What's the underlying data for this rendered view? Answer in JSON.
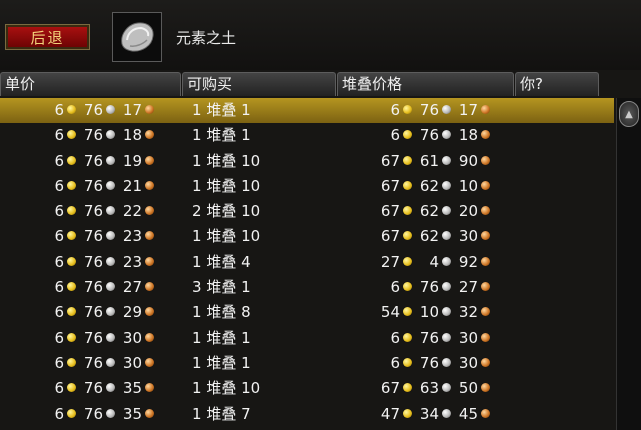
{
  "back_button": "后退",
  "item": {
    "name": "元素之土",
    "icon": "gray-ore-icon"
  },
  "columns": [
    "单价",
    "可购买",
    "堆叠价格",
    "你?"
  ],
  "colors": {
    "selected_row": "#b59520",
    "gold": "#e8c020",
    "silver": "#bcbcbc",
    "copper": "#d07828"
  },
  "rows": [
    {
      "unit": [
        "6",
        "76",
        "17"
      ],
      "qty": "1",
      "stack_word": "堆叠",
      "stack": "1",
      "total": [
        "6",
        "76",
        "17"
      ],
      "selected": true
    },
    {
      "unit": [
        "6",
        "76",
        "18"
      ],
      "qty": "1",
      "stack_word": "堆叠",
      "stack": "1",
      "total": [
        "6",
        "76",
        "18"
      ]
    },
    {
      "unit": [
        "6",
        "76",
        "19"
      ],
      "qty": "1",
      "stack_word": "堆叠",
      "stack": "10",
      "total": [
        "67",
        "61",
        "90"
      ]
    },
    {
      "unit": [
        "6",
        "76",
        "21"
      ],
      "qty": "1",
      "stack_word": "堆叠",
      "stack": "10",
      "total": [
        "67",
        "62",
        "10"
      ]
    },
    {
      "unit": [
        "6",
        "76",
        "22"
      ],
      "qty": "2",
      "stack_word": "堆叠",
      "stack": "10",
      "total": [
        "67",
        "62",
        "20"
      ]
    },
    {
      "unit": [
        "6",
        "76",
        "23"
      ],
      "qty": "1",
      "stack_word": "堆叠",
      "stack": "10",
      "total": [
        "67",
        "62",
        "30"
      ]
    },
    {
      "unit": [
        "6",
        "76",
        "23"
      ],
      "qty": "1",
      "stack_word": "堆叠",
      "stack": "4",
      "total": [
        "27",
        "4",
        "92"
      ]
    },
    {
      "unit": [
        "6",
        "76",
        "27"
      ],
      "qty": "3",
      "stack_word": "堆叠",
      "stack": "1",
      "total": [
        "6",
        "76",
        "27"
      ]
    },
    {
      "unit": [
        "6",
        "76",
        "29"
      ],
      "qty": "1",
      "stack_word": "堆叠",
      "stack": "8",
      "total": [
        "54",
        "10",
        "32"
      ]
    },
    {
      "unit": [
        "6",
        "76",
        "30"
      ],
      "qty": "1",
      "stack_word": "堆叠",
      "stack": "1",
      "total": [
        "6",
        "76",
        "30"
      ]
    },
    {
      "unit": [
        "6",
        "76",
        "30"
      ],
      "qty": "1",
      "stack_word": "堆叠",
      "stack": "1",
      "total": [
        "6",
        "76",
        "30"
      ]
    },
    {
      "unit": [
        "6",
        "76",
        "35"
      ],
      "qty": "1",
      "stack_word": "堆叠",
      "stack": "10",
      "total": [
        "67",
        "63",
        "50"
      ]
    },
    {
      "unit": [
        "6",
        "76",
        "35"
      ],
      "qty": "1",
      "stack_word": "堆叠",
      "stack": "7",
      "total": [
        "47",
        "34",
        "45"
      ]
    }
  ]
}
